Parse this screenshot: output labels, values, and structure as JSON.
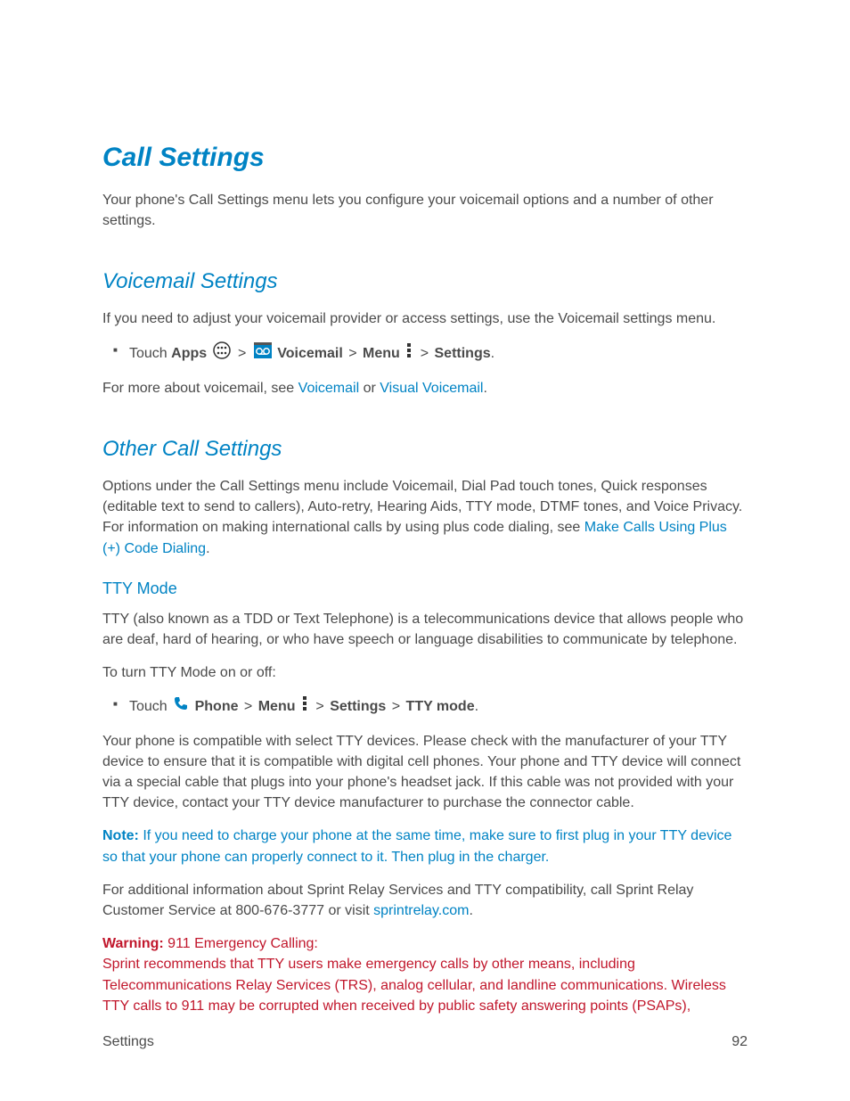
{
  "h1": "Call Settings",
  "intro": "Your phone's Call Settings menu lets you configure your voicemail options and a number of other settings.",
  "vm": {
    "heading": "Voicemail Settings",
    "intro": "If you need to adjust your voicemail provider or access settings, use the Voicemail settings menu.",
    "touch": "Touch ",
    "apps": "Apps",
    "voicemail": "Voicemail",
    "menu": "Menu",
    "settings": "Settings",
    "sep": " > ",
    "period": ".",
    "more_pre": "For more about voicemail, see ",
    "link1": "Voicemail",
    "or": " or ",
    "link2": "Visual Voicemail"
  },
  "oc": {
    "heading": "Other Call Settings",
    "p1_pre": "Options under the Call Settings menu include Voicemail, Dial Pad touch tones, Quick responses (editable text to send to callers), Auto-retry, Hearing Aids, TTY mode, DTMF tones, and Voice Privacy. For information on making international calls by using plus code dialing, see ",
    "link": "Make Calls Using Plus (+) Code Dialing",
    "p1_post": ".",
    "tty_h": "TTY Mode",
    "tty_p1": "TTY (also known as a TDD or Text Telephone) is a telecommunications device that allows people who are deaf, hard of hearing, or who have speech or language disabilities to communicate by telephone.",
    "tty_p2": "To turn TTY Mode on or off:",
    "touch": "Touch ",
    "phone": "Phone",
    "menu": "Menu",
    "settings": "Settings",
    "ttymode": "TTY mode",
    "sep": " > ",
    "period": ".",
    "tty_p3": "Your phone is compatible with select TTY devices. Please check with the manufacturer of your TTY device to ensure that it is compatible with digital cell phones. Your phone and TTY device will connect via a special cable that plugs into your phone's headset jack. If this cable was not provided with your TTY device, contact your TTY device manufacturer to purchase the connector cable.",
    "note_label": "Note:",
    "note_body": " If you need to charge your phone at the same time, make sure to first plug in your TTY device so that your phone can properly connect to it. Then plug in the charger.",
    "tty_p4_pre": "For additional information about Sprint Relay Services and TTY compatibility, call Sprint Relay Customer Service at 800-676-3777 or visit ",
    "tty_link": "sprintrelay.com",
    "tty_p4_post": ".",
    "warn_label": "Warning:",
    "warn_h": " 911 Emergency Calling:",
    "warn_body": "Sprint recommends that TTY users make emergency calls by other means, including Telecommunications Relay Services (TRS), analog cellular, and landline communications. Wireless TTY calls to 911 may be corrupted when received by public safety answering points (PSAPs),"
  },
  "footer": {
    "left": "Settings",
    "right": "92"
  }
}
